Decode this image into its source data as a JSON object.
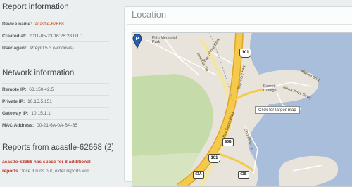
{
  "report": {
    "heading": "Report information",
    "rows": [
      {
        "label": "Device name:",
        "value": "acastle-62668",
        "highlight": true
      },
      {
        "label": "Created at:",
        "value": "2011-05-23 16:26:28 UTC",
        "highlight": false
      },
      {
        "label": "User agent:",
        "value": "Prey/0.5.3 (windows)",
        "highlight": false
      }
    ]
  },
  "network": {
    "heading": "Network information",
    "rows": [
      {
        "label": "Remote IP:",
        "value": "63.150.42.5"
      },
      {
        "label": "Private IP:",
        "value": "10.15.5.151"
      },
      {
        "label": "Gateway IP:",
        "value": "10.15.1.1"
      },
      {
        "label": "MAC Address:",
        "value": "00-21-6A-0A-BA-65"
      }
    ]
  },
  "reports": {
    "heading": "Reports from acastle-62668 (2)",
    "notice_red": "acastle-62668 has space for 8 additional reports",
    "notice_rest": "Once it runs out, older reports will"
  },
  "location": {
    "title": "Location",
    "tooltip": "Click for larger map",
    "labels": {
      "park": "Fifth Memorial Park",
      "bayshore_blvd_1": "Bay Shore Blvd",
      "bayshore_blvd_2": "Bay Shore Blvd",
      "bayshore_fwy": "Bayshore Fwy",
      "tanforan": "Tanforan Rd",
      "everett": "Everett College",
      "sierra": "Sierra Point Pkwy",
      "marina": "Marina Blvd",
      "shoreline": "Shoreline Ct",
      "shield_101_top": "101",
      "shield_101_bottom": "101",
      "shield_63b_1": "63B",
      "shield_63b_2": "63B",
      "shield_63a": "63A"
    }
  },
  "colors": {
    "water": "#a8bedb",
    "land": "#e8e4dc",
    "park": "#c6dbaa",
    "freeway": "#f5c94a",
    "accent_orange": "#c84a10",
    "accent_red": "#c0392b"
  }
}
